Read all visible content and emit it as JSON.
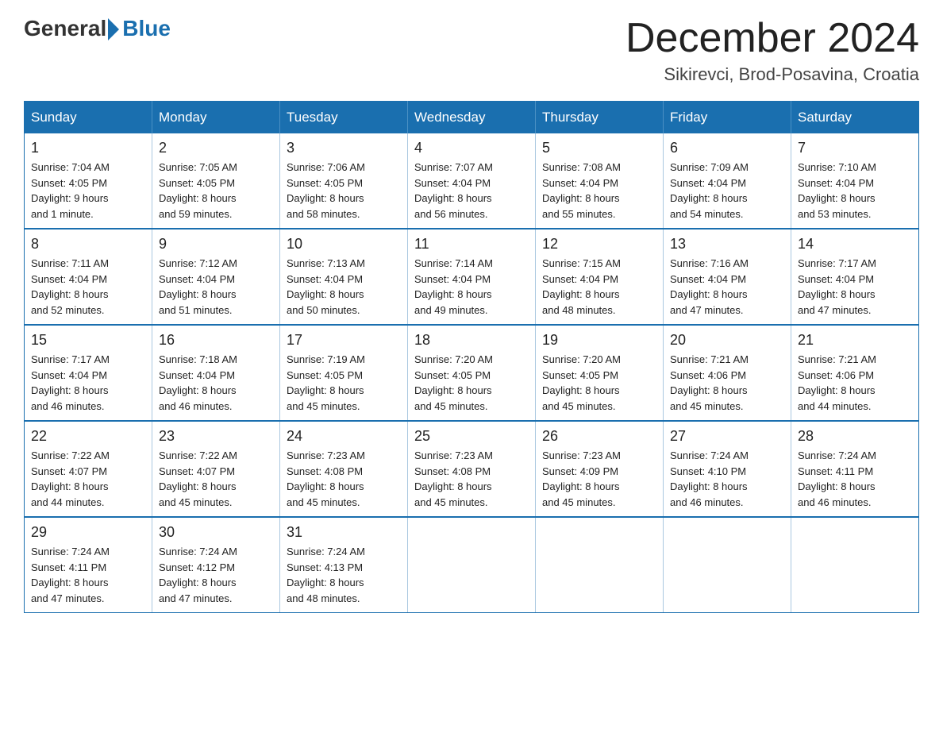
{
  "header": {
    "logo": {
      "general": "General",
      "blue": "Blue"
    },
    "title": "December 2024",
    "location": "Sikirevci, Brod-Posavina, Croatia"
  },
  "days_of_week": [
    "Sunday",
    "Monday",
    "Tuesday",
    "Wednesday",
    "Thursday",
    "Friday",
    "Saturday"
  ],
  "weeks": [
    [
      {
        "day": "1",
        "sunrise": "7:04 AM",
        "sunset": "4:05 PM",
        "daylight": "9 hours and 1 minute."
      },
      {
        "day": "2",
        "sunrise": "7:05 AM",
        "sunset": "4:05 PM",
        "daylight": "8 hours and 59 minutes."
      },
      {
        "day": "3",
        "sunrise": "7:06 AM",
        "sunset": "4:05 PM",
        "daylight": "8 hours and 58 minutes."
      },
      {
        "day": "4",
        "sunrise": "7:07 AM",
        "sunset": "4:04 PM",
        "daylight": "8 hours and 56 minutes."
      },
      {
        "day": "5",
        "sunrise": "7:08 AM",
        "sunset": "4:04 PM",
        "daylight": "8 hours and 55 minutes."
      },
      {
        "day": "6",
        "sunrise": "7:09 AM",
        "sunset": "4:04 PM",
        "daylight": "8 hours and 54 minutes."
      },
      {
        "day": "7",
        "sunrise": "7:10 AM",
        "sunset": "4:04 PM",
        "daylight": "8 hours and 53 minutes."
      }
    ],
    [
      {
        "day": "8",
        "sunrise": "7:11 AM",
        "sunset": "4:04 PM",
        "daylight": "8 hours and 52 minutes."
      },
      {
        "day": "9",
        "sunrise": "7:12 AM",
        "sunset": "4:04 PM",
        "daylight": "8 hours and 51 minutes."
      },
      {
        "day": "10",
        "sunrise": "7:13 AM",
        "sunset": "4:04 PM",
        "daylight": "8 hours and 50 minutes."
      },
      {
        "day": "11",
        "sunrise": "7:14 AM",
        "sunset": "4:04 PM",
        "daylight": "8 hours and 49 minutes."
      },
      {
        "day": "12",
        "sunrise": "7:15 AM",
        "sunset": "4:04 PM",
        "daylight": "8 hours and 48 minutes."
      },
      {
        "day": "13",
        "sunrise": "7:16 AM",
        "sunset": "4:04 PM",
        "daylight": "8 hours and 47 minutes."
      },
      {
        "day": "14",
        "sunrise": "7:17 AM",
        "sunset": "4:04 PM",
        "daylight": "8 hours and 47 minutes."
      }
    ],
    [
      {
        "day": "15",
        "sunrise": "7:17 AM",
        "sunset": "4:04 PM",
        "daylight": "8 hours and 46 minutes."
      },
      {
        "day": "16",
        "sunrise": "7:18 AM",
        "sunset": "4:04 PM",
        "daylight": "8 hours and 46 minutes."
      },
      {
        "day": "17",
        "sunrise": "7:19 AM",
        "sunset": "4:05 PM",
        "daylight": "8 hours and 45 minutes."
      },
      {
        "day": "18",
        "sunrise": "7:20 AM",
        "sunset": "4:05 PM",
        "daylight": "8 hours and 45 minutes."
      },
      {
        "day": "19",
        "sunrise": "7:20 AM",
        "sunset": "4:05 PM",
        "daylight": "8 hours and 45 minutes."
      },
      {
        "day": "20",
        "sunrise": "7:21 AM",
        "sunset": "4:06 PM",
        "daylight": "8 hours and 45 minutes."
      },
      {
        "day": "21",
        "sunrise": "7:21 AM",
        "sunset": "4:06 PM",
        "daylight": "8 hours and 44 minutes."
      }
    ],
    [
      {
        "day": "22",
        "sunrise": "7:22 AM",
        "sunset": "4:07 PM",
        "daylight": "8 hours and 44 minutes."
      },
      {
        "day": "23",
        "sunrise": "7:22 AM",
        "sunset": "4:07 PM",
        "daylight": "8 hours and 45 minutes."
      },
      {
        "day": "24",
        "sunrise": "7:23 AM",
        "sunset": "4:08 PM",
        "daylight": "8 hours and 45 minutes."
      },
      {
        "day": "25",
        "sunrise": "7:23 AM",
        "sunset": "4:08 PM",
        "daylight": "8 hours and 45 minutes."
      },
      {
        "day": "26",
        "sunrise": "7:23 AM",
        "sunset": "4:09 PM",
        "daylight": "8 hours and 45 minutes."
      },
      {
        "day": "27",
        "sunrise": "7:24 AM",
        "sunset": "4:10 PM",
        "daylight": "8 hours and 46 minutes."
      },
      {
        "day": "28",
        "sunrise": "7:24 AM",
        "sunset": "4:11 PM",
        "daylight": "8 hours and 46 minutes."
      }
    ],
    [
      {
        "day": "29",
        "sunrise": "7:24 AM",
        "sunset": "4:11 PM",
        "daylight": "8 hours and 47 minutes."
      },
      {
        "day": "30",
        "sunrise": "7:24 AM",
        "sunset": "4:12 PM",
        "daylight": "8 hours and 47 minutes."
      },
      {
        "day": "31",
        "sunrise": "7:24 AM",
        "sunset": "4:13 PM",
        "daylight": "8 hours and 48 minutes."
      },
      null,
      null,
      null,
      null
    ]
  ],
  "labels": {
    "sunrise": "Sunrise:",
    "sunset": "Sunset:",
    "daylight": "Daylight:"
  }
}
